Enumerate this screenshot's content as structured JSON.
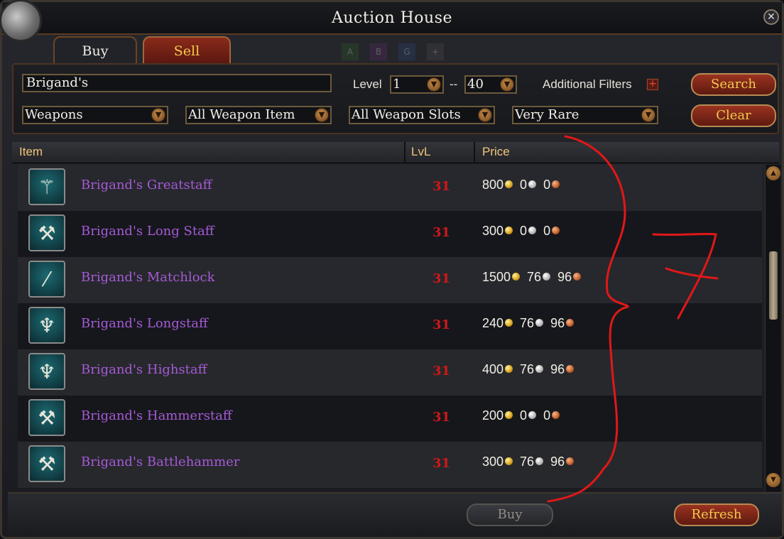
{
  "window": {
    "title": "Auction House"
  },
  "tabs": [
    {
      "label": "Buy",
      "active": true
    },
    {
      "label": "Sell",
      "active": false
    }
  ],
  "faded_squares": [
    "A",
    "B",
    "G",
    "+"
  ],
  "filters": {
    "search_value": "Brigand's",
    "level_label": "Level",
    "level_min": "1",
    "level_separator": "--",
    "level_max": "40",
    "additional_filters_label": "Additional Filters",
    "category": "Weapons",
    "item_type": "All Weapon Item",
    "slot": "All Weapon Slots",
    "rarity": "Very Rare"
  },
  "buttons": {
    "search": "Search",
    "clear": "Clear",
    "buy": "Buy",
    "refresh": "Refresh"
  },
  "table": {
    "headers": {
      "item": "Item",
      "level": "LvL",
      "price": "Price"
    },
    "rows": [
      {
        "name": "Brigand's Greatstaff",
        "level": "31",
        "gold": "800",
        "silver": "0",
        "copper": "0",
        "icon": "staff-icon"
      },
      {
        "name": "Brigand's Long Staff",
        "level": "31",
        "gold": "300",
        "silver": "0",
        "copper": "0",
        "icon": "staff-icon"
      },
      {
        "name": "Brigand's Matchlock",
        "level": "31",
        "gold": "1500",
        "silver": "76",
        "copper": "96",
        "icon": "gun-icon"
      },
      {
        "name": "Brigand's Longstaff",
        "level": "31",
        "gold": "240",
        "silver": "76",
        "copper": "96",
        "icon": "staff-icon"
      },
      {
        "name": "Brigand's Highstaff",
        "level": "31",
        "gold": "400",
        "silver": "76",
        "copper": "96",
        "icon": "staff-icon"
      },
      {
        "name": "Brigand's Hammerstaff",
        "level": "31",
        "gold": "200",
        "silver": "0",
        "copper": "0",
        "icon": "hammer-icon"
      },
      {
        "name": "Brigand's Battlehammer",
        "level": "31",
        "gold": "300",
        "silver": "76",
        "copper": "96",
        "icon": "hammer-icon"
      }
    ]
  },
  "colors": {
    "item_name": "#a55ad6",
    "level": "#d01818",
    "header": "#f1c77a",
    "annotation": "#e01818"
  },
  "annotation": {
    "text": "7"
  }
}
